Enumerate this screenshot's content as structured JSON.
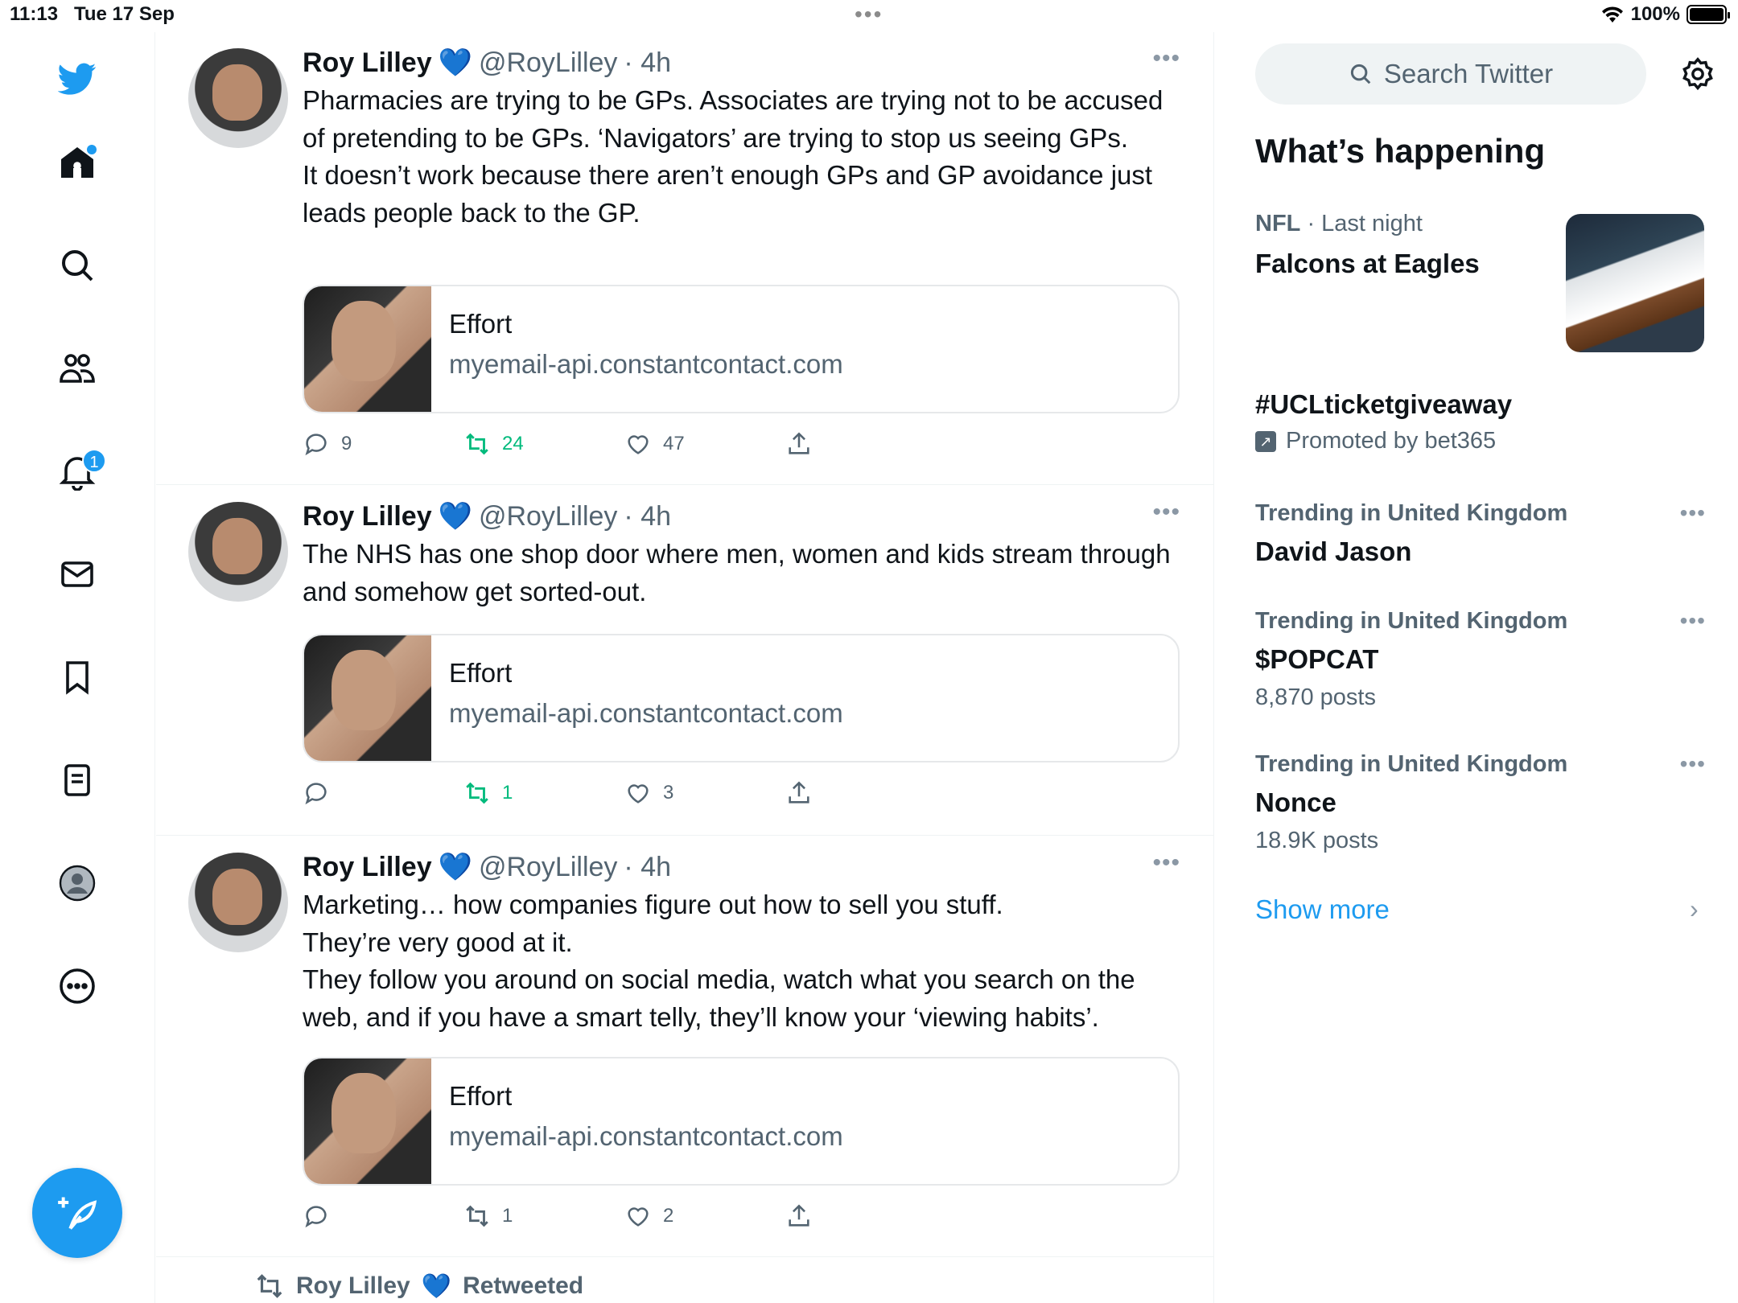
{
  "status_bar": {
    "time": "11:13",
    "date": "Tue 17 Sep",
    "battery": "100%"
  },
  "nav": {
    "items": [
      "twitter-logo",
      "home",
      "explore",
      "communities",
      "notifications",
      "messages",
      "bookmarks",
      "lists",
      "profile",
      "more"
    ],
    "notification_count": "1"
  },
  "tweets": [
    {
      "name": "Roy Lilley",
      "handle": "@RoyLilley",
      "time": "· 4h",
      "text": "Pharmacies are trying to be GPs. Associates are trying not to be accused of pretending to be GPs. ‘Navigators’ are trying to stop us seeing GPs.\nIt doesn’t work because there aren’t enough GPs and GP avoidance just leads people back to the GP.",
      "card": {
        "title": "Effort",
        "domain": "myemail-api.constantcontact.com"
      },
      "replies": "9",
      "retweets": "24",
      "likes": "47"
    },
    {
      "name": "Roy Lilley",
      "handle": "@RoyLilley",
      "time": "· 4h",
      "text": "The NHS has one shop door where men, women and kids stream through and somehow get sorted-out.",
      "card": {
        "title": "Effort",
        "domain": "myemail-api.constantcontact.com"
      },
      "replies": "",
      "retweets": "1",
      "likes": "3"
    },
    {
      "name": "Roy Lilley",
      "handle": "@RoyLilley",
      "time": "· 4h",
      "text": "Marketing… how companies figure out how to sell you stuff.\nThey’re very good at it.\nThey follow you around on social media, watch what you search on the web, and if you have a smart telly, they’ll know your ‘viewing habits’.",
      "card": {
        "title": "Effort",
        "domain": "myemail-api.constantcontact.com"
      },
      "replies": "",
      "retweets": "1",
      "likes": "2"
    }
  ],
  "retweeted": {
    "name": "Roy Lilley",
    "label": "Retweeted"
  },
  "sidebar": {
    "search_placeholder": "Search Twitter",
    "whats_happening": "What’s happening",
    "nfl": {
      "category": "NFL",
      "time": "· Last night",
      "title": "Falcons at Eagles"
    },
    "promoted": {
      "title": "#UCLticketgiveaway",
      "label": "Promoted by bet365"
    },
    "trends": [
      {
        "meta": "Trending in United Kingdom",
        "title": "David Jason",
        "posts": ""
      },
      {
        "meta": "Trending in United Kingdom",
        "title": "$POPCAT",
        "posts": "8,870 posts"
      },
      {
        "meta": "Trending in United Kingdom",
        "title": "Nonce",
        "posts": "18.9K posts"
      }
    ],
    "show_more": "Show more"
  },
  "colors": {
    "accent": "#1d9bf0",
    "retweet_active": "#00ba7c",
    "secondary_text": "#536471"
  }
}
